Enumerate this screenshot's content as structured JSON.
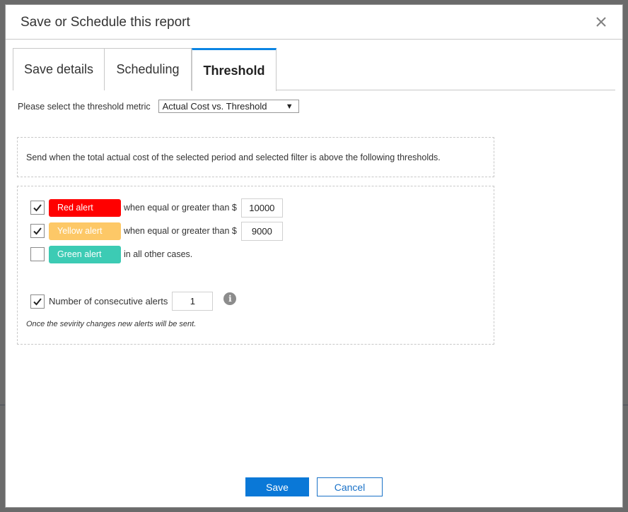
{
  "dialog": {
    "title": "Save or Schedule this report",
    "close_icon": "close-icon"
  },
  "tabs": [
    {
      "label": "Save details",
      "active": false
    },
    {
      "label": "Scheduling",
      "active": false
    },
    {
      "label": "Threshold",
      "active": true
    }
  ],
  "threshold": {
    "metric_label": "Please select the threshold metric",
    "metric_selected": "Actual Cost vs. Threshold",
    "description": "Send when the total actual cost of the selected period and selected filter is above the following thresholds.",
    "rules": [
      {
        "checked": true,
        "badge": "Red alert",
        "color": "#ff0000",
        "text": "when equal or greater than $",
        "value": "10000"
      },
      {
        "checked": true,
        "badge": "Yellow alert",
        "color": "#fdc867",
        "text": "when equal or greater than $",
        "value": "9000"
      },
      {
        "checked": false,
        "badge": "Green alert",
        "color": "#3ccbb4",
        "text": "in all other cases."
      }
    ],
    "consecutive": {
      "checked": true,
      "label": "Number of consecutive alerts",
      "value": "1",
      "info_icon": "info-icon"
    },
    "note": "Once the sevirity changes new alerts will be sent."
  },
  "footer": {
    "save_label": "Save",
    "cancel_label": "Cancel"
  },
  "colors": {
    "accent": "#0b84e3",
    "primary_button": "#0a78d7"
  }
}
